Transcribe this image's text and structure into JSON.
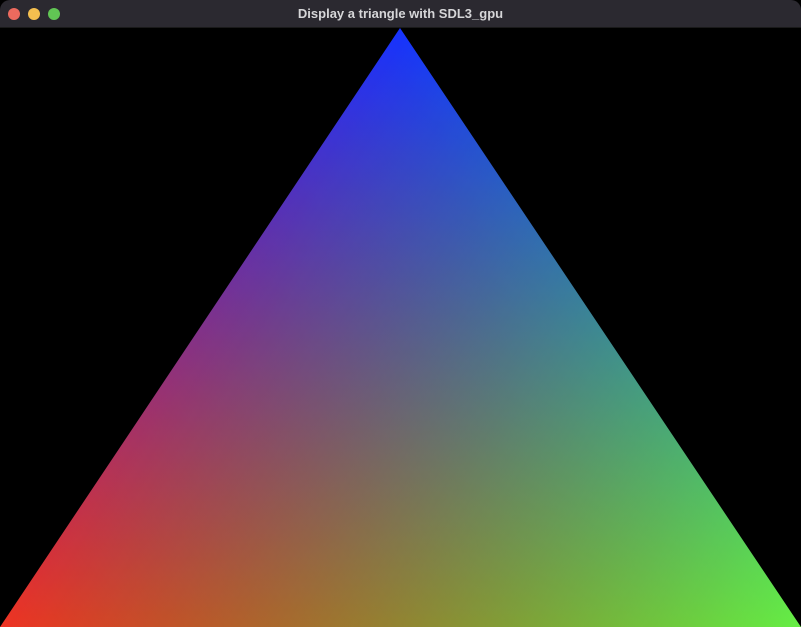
{
  "window": {
    "title": "Display a triangle with SDL3_gpu"
  },
  "traffic_lights": [
    {
      "name": "close-button",
      "color": "#ec6a5e"
    },
    {
      "name": "minimize-button",
      "color": "#f4bf4f"
    },
    {
      "name": "zoom-button",
      "color": "#61c554"
    }
  ],
  "viewport": {
    "background": "#000000",
    "triangle": {
      "vertex_colors": {
        "top": "#0022ff",
        "bottom_left": "#ee3322",
        "bottom_right": "#66ee44"
      }
    }
  }
}
